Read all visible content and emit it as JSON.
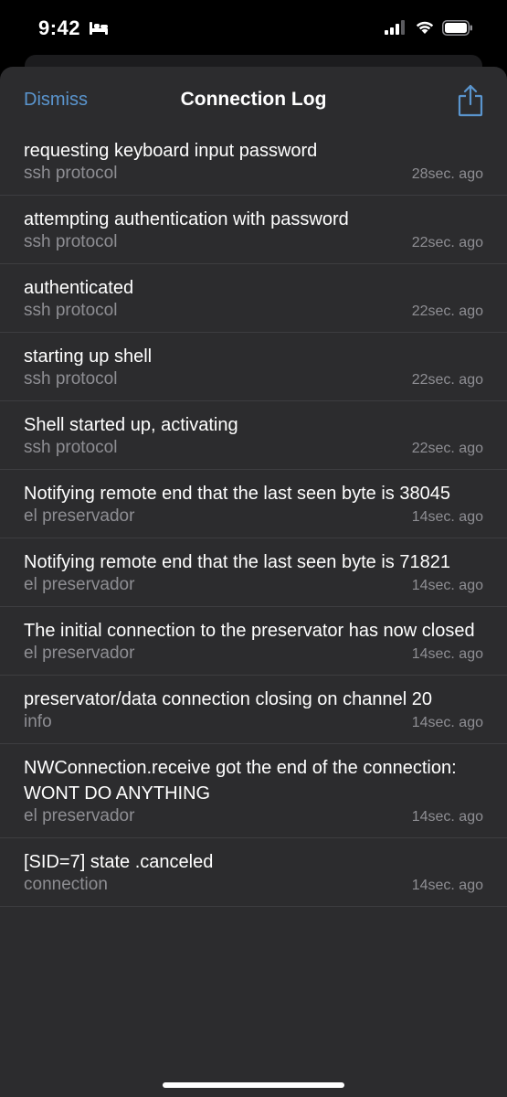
{
  "status_bar": {
    "time": "9:42"
  },
  "nav": {
    "dismiss_label": "Dismiss",
    "title": "Connection Log",
    "share_icon": "share-icon"
  },
  "log": [
    {
      "message": "requesting keyboard input password",
      "source": "ssh protocol",
      "time": "28sec. ago"
    },
    {
      "message": "attempting authentication with password",
      "source": "ssh protocol",
      "time": "22sec. ago"
    },
    {
      "message": "authenticated",
      "source": "ssh protocol",
      "time": "22sec. ago"
    },
    {
      "message": "starting up shell",
      "source": "ssh protocol",
      "time": "22sec. ago"
    },
    {
      "message": "Shell started up, activating",
      "source": "ssh protocol",
      "time": "22sec. ago"
    },
    {
      "message": "Notifying remote end that the last seen byte is 38045",
      "source": "el preservador",
      "time": "14sec. ago"
    },
    {
      "message": "Notifying remote end that the last seen byte is 71821",
      "source": "el preservador",
      "time": "14sec. ago"
    },
    {
      "message": "The initial connection to the preservator has now closed",
      "source": "el preservador",
      "time": "14sec. ago"
    },
    {
      "message": "preservator/data connection closing on channel 20",
      "source": "info",
      "time": "14sec. ago"
    },
    {
      "message": "NWConnection.receive got the end of the connection: WONT DO ANYTHING",
      "source": "el preservador",
      "time": "14sec. ago"
    },
    {
      "message": "[SID=7] state .canceled",
      "source": "connection",
      "time": "14sec. ago"
    }
  ],
  "colors": {
    "accent": "#5a95ce",
    "sheet_bg": "#2c2c2e",
    "secondary_text": "#8e8e93"
  }
}
